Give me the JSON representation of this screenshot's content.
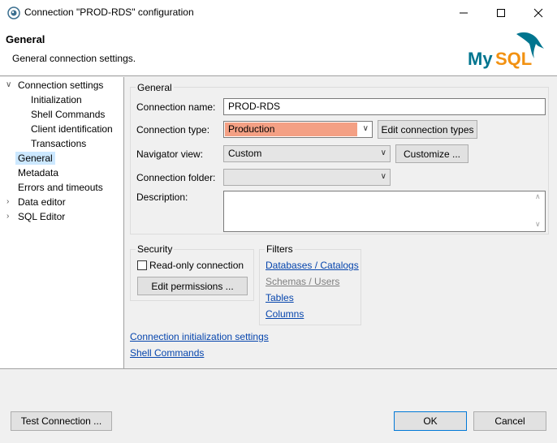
{
  "window": {
    "title": "Connection \"PROD-RDS\" configuration",
    "controls": {
      "minimize": "—",
      "maximize": "☐",
      "close": "✕"
    }
  },
  "header": {
    "title": "General",
    "subtitle": "General connection settings.",
    "logo_text": "MySQL",
    "logo_colors": {
      "my": "#00758f",
      "sql": "#f29111"
    }
  },
  "nav": {
    "items": [
      {
        "label": "Connection settings"
      },
      {
        "label": "Initialization"
      },
      {
        "label": "Shell Commands"
      },
      {
        "label": "Client identification"
      },
      {
        "label": "Transactions"
      },
      {
        "label": "General"
      },
      {
        "label": "Metadata"
      },
      {
        "label": "Errors and timeouts"
      },
      {
        "label": "Data editor"
      },
      {
        "label": "SQL Editor"
      }
    ]
  },
  "general": {
    "group_label": "General",
    "connection_name_label": "Connection name:",
    "connection_name_value": "PROD-RDS",
    "connection_type_label": "Connection type:",
    "connection_type_value": "Production",
    "connection_type_color": "#f4a084",
    "edit_types_button": "Edit connection types",
    "navigator_view_label": "Navigator view:",
    "navigator_view_value": "Custom",
    "customize_button": "Customize ...",
    "connection_folder_label": "Connection folder:",
    "connection_folder_value": "",
    "description_label": "Description:",
    "description_value": ""
  },
  "security": {
    "group_label": "Security",
    "readonly_label": "Read-only connection",
    "readonly_checked": false,
    "edit_permissions_button": "Edit permissions ..."
  },
  "filters": {
    "group_label": "Filters",
    "links": [
      {
        "label": "Databases / Catalogs",
        "enabled": true
      },
      {
        "label": "Schemas / Users",
        "enabled": false
      },
      {
        "label": "Tables",
        "enabled": true
      },
      {
        "label": "Columns",
        "enabled": true
      }
    ]
  },
  "links": {
    "init_settings": "Connection initialization settings",
    "shell_commands": "Shell Commands"
  },
  "footer": {
    "test_connection": "Test Connection ...",
    "ok": "OK",
    "cancel": "Cancel"
  }
}
